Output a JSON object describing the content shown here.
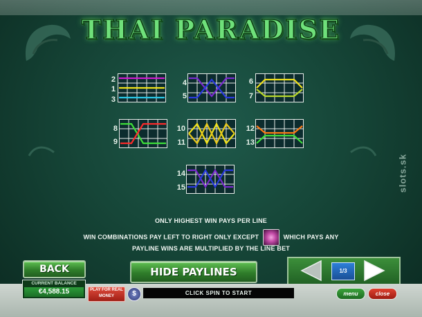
{
  "game": {
    "title": "THAI PARADISE",
    "watermark": "slots.sk"
  },
  "paylines": [
    {
      "labels": [
        "2",
        "1",
        "3"
      ]
    },
    {
      "labels": [
        "4",
        "5"
      ]
    },
    {
      "labels": [
        "6",
        "7"
      ]
    },
    {
      "labels": [
        "8",
        "9"
      ]
    },
    {
      "labels": [
        "10",
        "11"
      ]
    },
    {
      "labels": [
        "12",
        "13"
      ]
    },
    {
      "labels": [
        "14",
        "15"
      ]
    }
  ],
  "rules": {
    "line1": "ONLY HIGHEST WIN PAYS PER LINE",
    "line2_pre": "WIN COMBINATIONS PAY LEFT TO RIGHT ONLY EXCEPT",
    "line2_post": "WHICH PAYS ANY",
    "line3": "PAYLINE WINS ARE MULTIPLIED BY THE LINE BET"
  },
  "controls": {
    "back_label": "BACK",
    "hide_paylines_label": "HIDE PAYLINES",
    "page_indicator": "1/3",
    "balance_label": "CURRENT BALANCE",
    "balance_value": "€4,588.15",
    "play_real_label": "PLAY FOR REAL MONEY",
    "coin_symbol": "$",
    "status_message": "CLICK SPIN TO START",
    "menu_label": "menu",
    "close_label": "close"
  },
  "colors": {
    "title_green": "#6fe07a",
    "line_magenta": "#d21ad2",
    "line_yellow": "#f2e21a",
    "line_cyan": "#2ac8e8",
    "line_purple": "#7a2ad0",
    "line_orange": "#ff7a10",
    "line_green": "#3ee03a",
    "line_red": "#ff2a2a",
    "line_blue": "#2a3ae0"
  }
}
